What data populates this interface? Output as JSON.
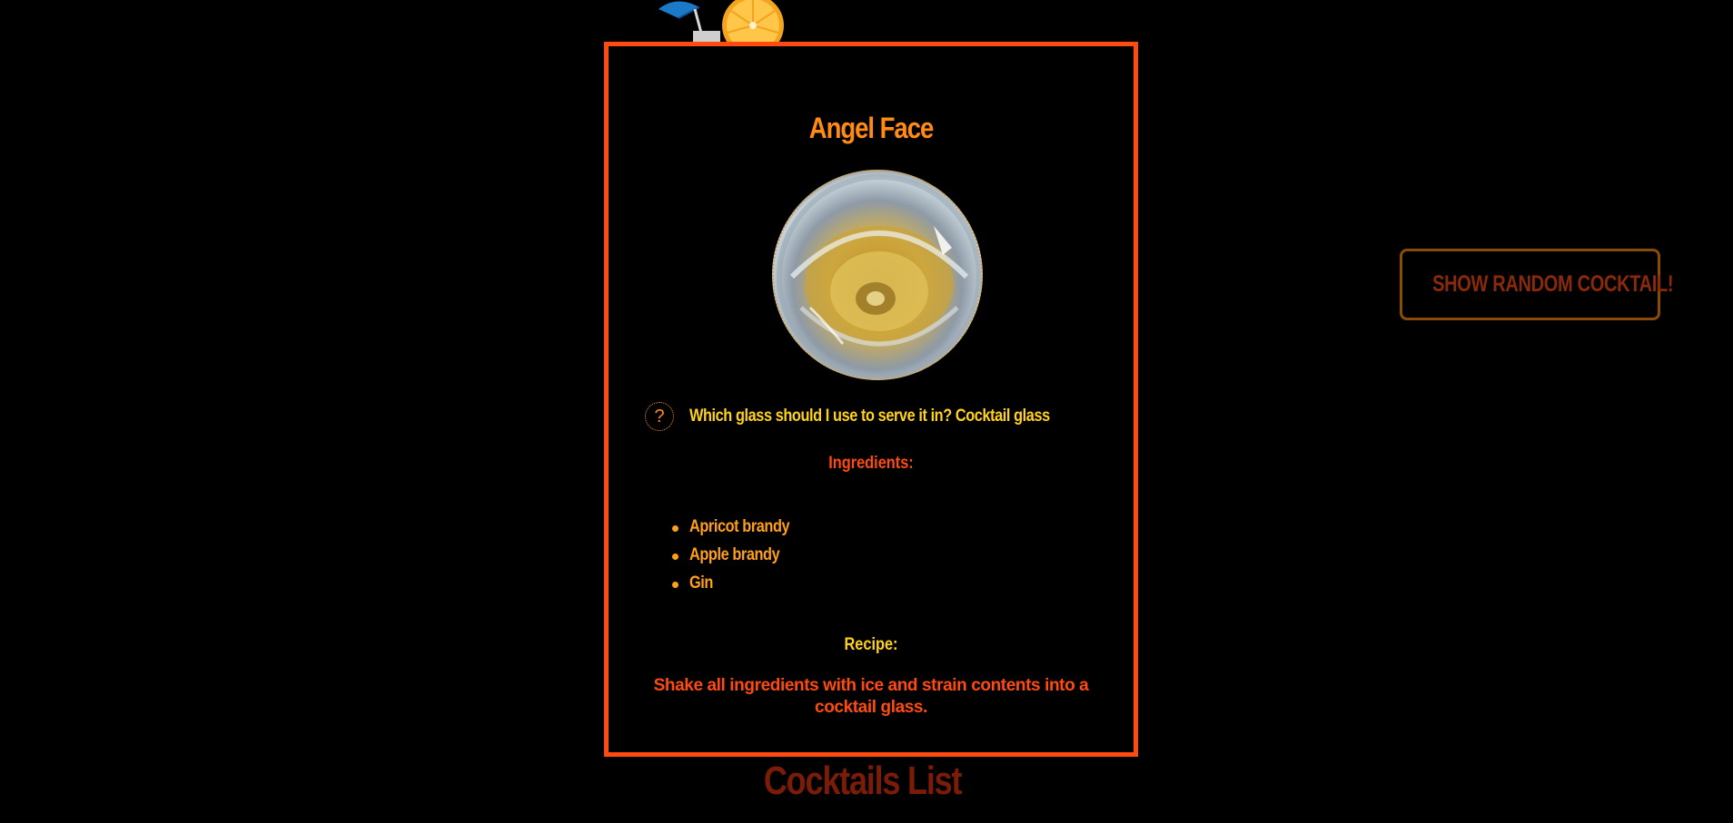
{
  "cocktail": {
    "name": "Angel Face",
    "image_icon": "cocktail-glass-photo",
    "glass_question": "Which glass should I use to serve it in? Cocktail glass",
    "help_icon": "question-mark-icon",
    "help_glyph": "?",
    "ingredients_heading": "Ingredients:",
    "ingredients": [
      "Apricot brandy",
      "Apple brandy",
      "Gin"
    ],
    "recipe_heading": "Recipe:",
    "recipe": "Shake all ingredients with ice and strain contents into a cocktail glass."
  },
  "actions": {
    "random_button_label": "SHOW RANDOM COCKTAIL!"
  },
  "list": {
    "title": "Cocktails List"
  },
  "decor": {
    "icon": "cocktail-umbrella-orange-slice-icon"
  },
  "colors": {
    "background": "#000000",
    "card_border": "#ff4a10",
    "title": "#ff8a14",
    "glass_text": "#ffd21a",
    "ingredients_heading": "#ff4a10",
    "ingredient_items": "#ff9f1a",
    "recipe_heading": "#ffd21a",
    "recipe_text": "#ff4a10",
    "button_border": "#8a4b06",
    "button_text": "#8a2a0a",
    "list_title": "#7a1c08"
  }
}
